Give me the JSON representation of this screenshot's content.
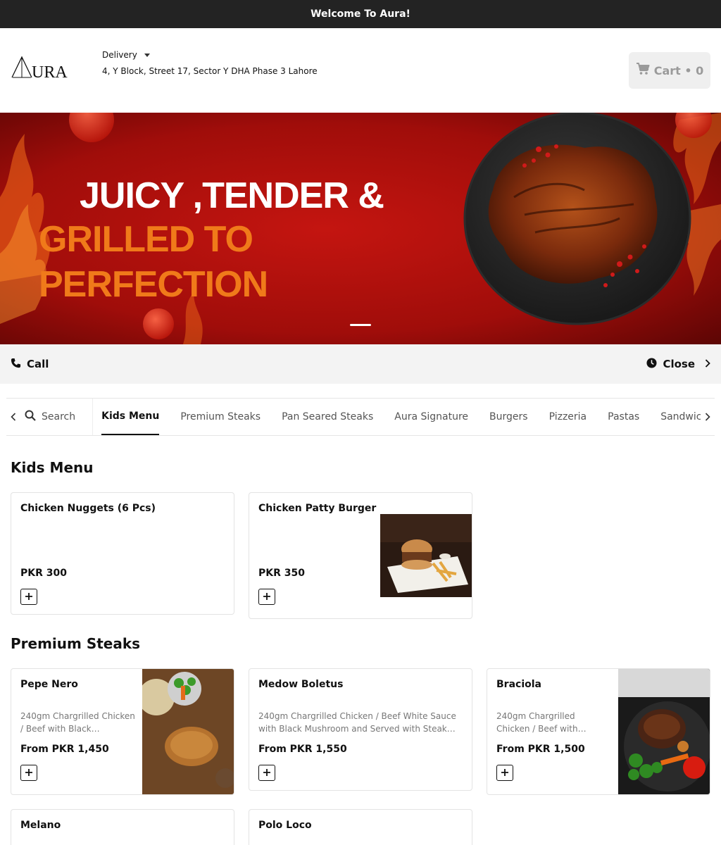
{
  "top_bar": {
    "welcome": "Welcome To Aura!"
  },
  "header": {
    "logo_text": "AURA",
    "delivery_mode": "Delivery",
    "address": "4, Y Block, Street 17, Sector Y DHA Phase 3 Lahore",
    "cart_label": "Cart • 0"
  },
  "banner": {
    "headline_line1": "JUICY ,TENDER &",
    "headline_line2": "GRILLED TO PERFECTION"
  },
  "info_bar": {
    "call_label": "Call",
    "hours_label": "Close"
  },
  "category_nav": {
    "search_label": "Search",
    "tabs": [
      "Kids Menu",
      "Premium Steaks",
      "Pan Seared Steaks",
      "Aura Signature",
      "Burgers",
      "Pizzeria",
      "Pastas",
      "Sandwich"
    ],
    "active_tab": "Kids Menu"
  },
  "sections": [
    {
      "title": "Kids Menu",
      "items": [
        {
          "name": "Chicken Nuggets (6 Pcs)",
          "description": "",
          "price": "PKR 300",
          "image": "none"
        },
        {
          "name": "Chicken Patty Burger",
          "description": "",
          "price": "PKR 350",
          "image": "burger-with-fries"
        }
      ]
    },
    {
      "title": "Premium Steaks",
      "items": [
        {
          "name": "Pepe Nero",
          "description": "240gm Chargrilled Chicken / Beef with Black…",
          "price": "From PKR 1,450",
          "image": "steak-on-board"
        },
        {
          "name": "Medow Boletus",
          "description": "240gm Chargrilled Chicken / Beef White Sauce with Black Mushroom and Served with Steak…",
          "price": "From PKR 1,550",
          "image": "none"
        },
        {
          "name": "Braciola",
          "description": "240gm Chargrilled Chicken / Beef with…",
          "price": "From PKR 1,500",
          "image": "steak-with-vegetables"
        },
        {
          "name": "Melano",
          "description": "",
          "price": "",
          "image": "none"
        },
        {
          "name": "Polo Loco",
          "description": "",
          "price": "",
          "image": "none"
        }
      ]
    }
  ],
  "colors": {
    "top_bar": "#232323",
    "banner_red": "#b01010",
    "banner_orange": "#f07a1a",
    "cart_bg": "#efefef",
    "info_bar": "#f3f3f3"
  }
}
